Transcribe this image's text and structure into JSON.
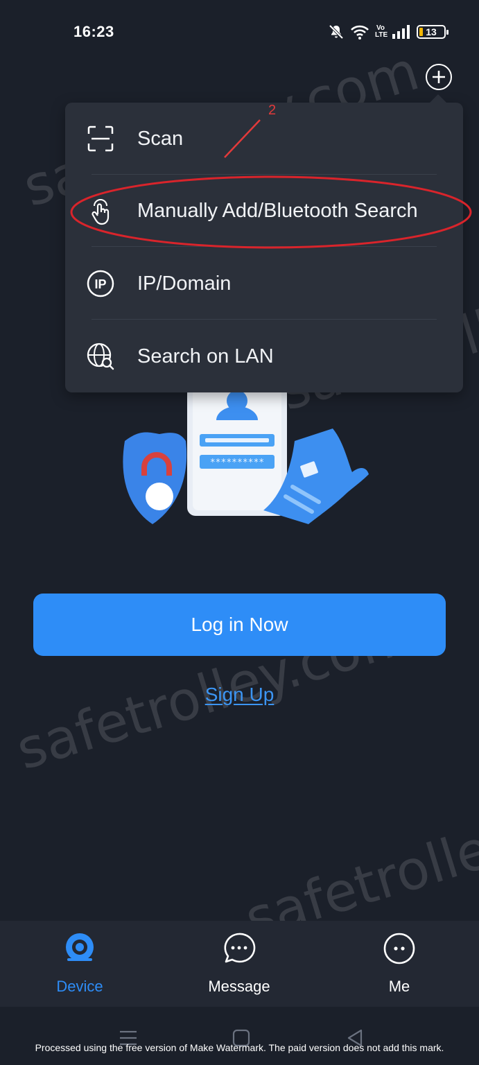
{
  "status_bar": {
    "time": "16:23",
    "network_label": "Vo LTE",
    "battery_level": "13",
    "icons": [
      "notifications-off-icon",
      "wifi-icon",
      "volte-icon",
      "signal-icon",
      "battery-icon"
    ]
  },
  "header": {
    "add_icon": "plus-circle-icon"
  },
  "menu": {
    "items": [
      {
        "label": "Scan",
        "icon": "scan-icon"
      },
      {
        "label": "Manually Add/Bluetooth Search",
        "icon": "hand-pointer-icon"
      },
      {
        "label": "IP/Domain",
        "icon": "ip-icon"
      },
      {
        "label": "Search on LAN",
        "icon": "globe-search-icon"
      }
    ]
  },
  "annotation": {
    "number": "2",
    "color": "#e23a3a"
  },
  "illustration": {
    "password_mask": "**********"
  },
  "main": {
    "login_label": "Log in Now",
    "signup_label": "Sign Up"
  },
  "watermark": {
    "text": "safetrolley.com"
  },
  "tabbar": {
    "tabs": [
      {
        "label": "Device",
        "icon": "camera-icon",
        "active": true
      },
      {
        "label": "Message",
        "icon": "chat-bubble-icon",
        "active": false
      },
      {
        "label": "Me",
        "icon": "profile-face-icon",
        "active": false
      }
    ]
  },
  "footer_note": "Processed using the free version of Make Watermark. The paid version does not add this mark.",
  "colors": {
    "background": "#1b202a",
    "accent": "#2e8df7",
    "menu_bg": "#2b303a",
    "annotation": "#e23a3a"
  }
}
